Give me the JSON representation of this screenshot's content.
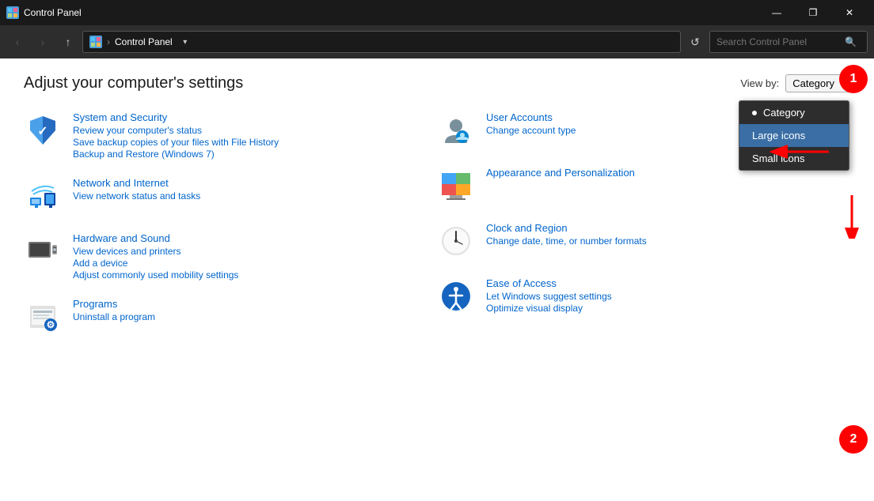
{
  "window": {
    "title": "Control Panel",
    "icon": "CP"
  },
  "titlebar": {
    "minimize": "—",
    "maximize": "❐",
    "close": "✕"
  },
  "addressbar": {
    "back": "‹",
    "forward": "›",
    "up": "↑",
    "address_icon": "CP",
    "address_path": "Control Panel",
    "refresh": "↺",
    "search_placeholder": "Search Control Panel"
  },
  "header": {
    "title": "Adjust your computer's settings",
    "viewby_label": "View by:",
    "viewby_value": "Category"
  },
  "dropdown": {
    "items": [
      {
        "label": "Category",
        "has_dot": true,
        "selected": false
      },
      {
        "label": "Large icons",
        "has_dot": false,
        "selected": true
      },
      {
        "label": "Small icons",
        "has_dot": false,
        "selected": false
      }
    ]
  },
  "settings": {
    "left": [
      {
        "id": "system-security",
        "title": "System and Security",
        "links": [
          "Review your computer's status",
          "Save backup copies of your files with File History",
          "Backup and Restore (Windows 7)"
        ]
      },
      {
        "id": "network-internet",
        "title": "Network and Internet",
        "links": [
          "View network status and tasks"
        ]
      },
      {
        "id": "hardware-sound",
        "title": "Hardware and Sound",
        "links": [
          "View devices and printers",
          "Add a device",
          "Adjust commonly used mobility settings"
        ]
      },
      {
        "id": "programs",
        "title": "Programs",
        "links": [
          "Uninstall a program"
        ]
      }
    ],
    "right": [
      {
        "id": "user-accounts",
        "title": "User Accounts",
        "links": [
          "Change account type"
        ]
      },
      {
        "id": "appearance",
        "title": "Appearance and Personalization",
        "links": []
      },
      {
        "id": "clock-region",
        "title": "Clock and Region",
        "links": [
          "Change date, time, or number formats"
        ]
      },
      {
        "id": "ease-access",
        "title": "Ease of Access",
        "links": [
          "Let Windows suggest settings",
          "Optimize visual display"
        ]
      }
    ]
  },
  "annotations": {
    "one": "1",
    "two": "2"
  }
}
